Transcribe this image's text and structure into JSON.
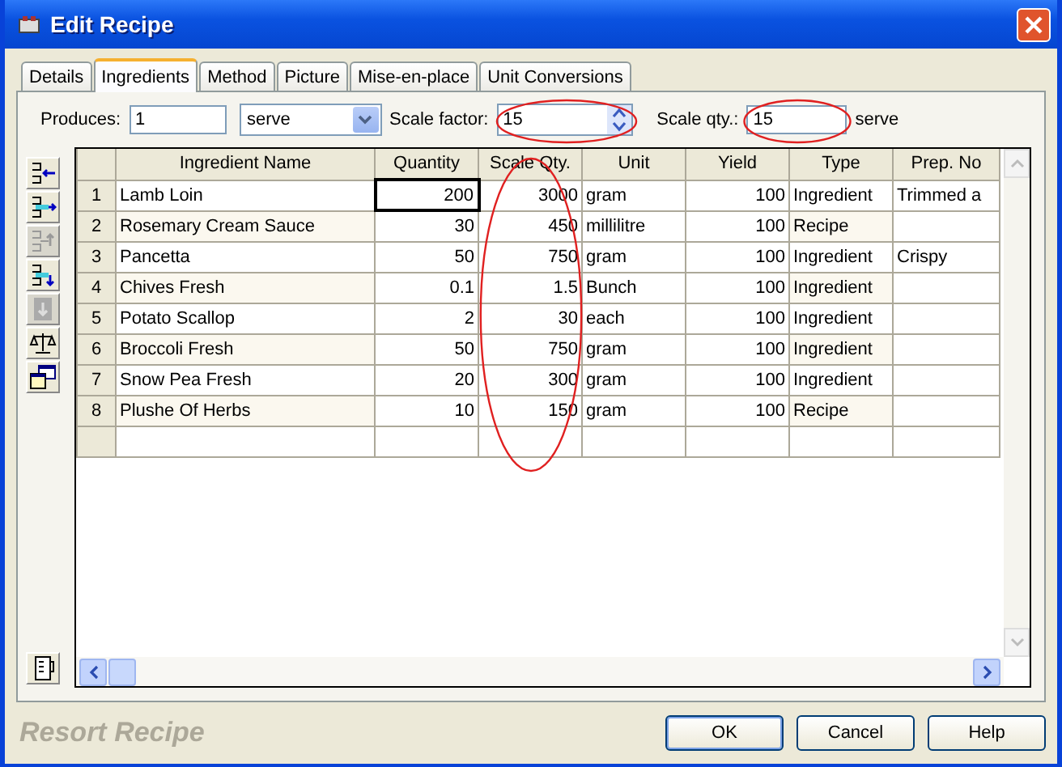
{
  "window": {
    "title": "Edit Recipe"
  },
  "tabs": [
    {
      "label": "Details",
      "selected": false
    },
    {
      "label": "Ingredients",
      "selected": true
    },
    {
      "label": "Method",
      "selected": false
    },
    {
      "label": "Picture",
      "selected": false
    },
    {
      "label": "Mise-en-place",
      "selected": false
    },
    {
      "label": "Unit Conversions",
      "selected": false
    }
  ],
  "produces": {
    "label": "Produces:",
    "value": "1",
    "unit": "serve"
  },
  "scale_factor": {
    "label": "Scale factor:",
    "value": "15"
  },
  "scale_qty": {
    "label": "Scale qty.:",
    "value": "15",
    "unit": "serve"
  },
  "tools": [
    {
      "kind": "indent-left",
      "disabled": false
    },
    {
      "kind": "indent-right",
      "disabled": false
    },
    {
      "kind": "move-up",
      "disabled": true
    },
    {
      "kind": "move-down",
      "disabled": false
    },
    {
      "kind": "insert",
      "disabled": true
    },
    {
      "kind": "scale",
      "disabled": false
    },
    {
      "kind": "windows",
      "disabled": false
    }
  ],
  "table": {
    "columns": [
      "",
      "Ingredient Name",
      "Quantity",
      "Scale Qty.",
      "Unit",
      "Yield",
      "Type",
      "Prep. No"
    ],
    "rows": [
      {
        "focused": true,
        "cells": [
          "1",
          "Lamb Loin",
          "200",
          "3000",
          "gram",
          "100",
          "Ingredient",
          "Trimmed a"
        ]
      },
      {
        "focused": false,
        "cells": [
          "2",
          "Rosemary Cream Sauce",
          "30",
          "450",
          "millilitre",
          "100",
          "Recipe",
          ""
        ]
      },
      {
        "focused": false,
        "cells": [
          "3",
          "Pancetta",
          "50",
          "750",
          "gram",
          "100",
          "Ingredient",
          "Crispy"
        ]
      },
      {
        "focused": false,
        "cells": [
          "4",
          "Chives Fresh",
          "0.1",
          "1.5",
          "Bunch",
          "100",
          "Ingredient",
          ""
        ]
      },
      {
        "focused": false,
        "cells": [
          "5",
          "Potato Scallop",
          "2",
          "30",
          "each",
          "100",
          "Ingredient",
          ""
        ]
      },
      {
        "focused": false,
        "cells": [
          "6",
          "Broccoli Fresh",
          "50",
          "750",
          "gram",
          "100",
          "Ingredient",
          ""
        ]
      },
      {
        "focused": false,
        "cells": [
          "7",
          "Snow Pea Fresh",
          "20",
          "300",
          "gram",
          "100",
          "Ingredient",
          ""
        ]
      },
      {
        "focused": false,
        "cells": [
          "8",
          "Plushe Of Herbs",
          "10",
          "150",
          "gram",
          "100",
          "Recipe",
          ""
        ]
      }
    ]
  },
  "footer": {
    "brand": "Resort Recipe"
  },
  "buttons": [
    "OK",
    "Cancel",
    "Help"
  ]
}
